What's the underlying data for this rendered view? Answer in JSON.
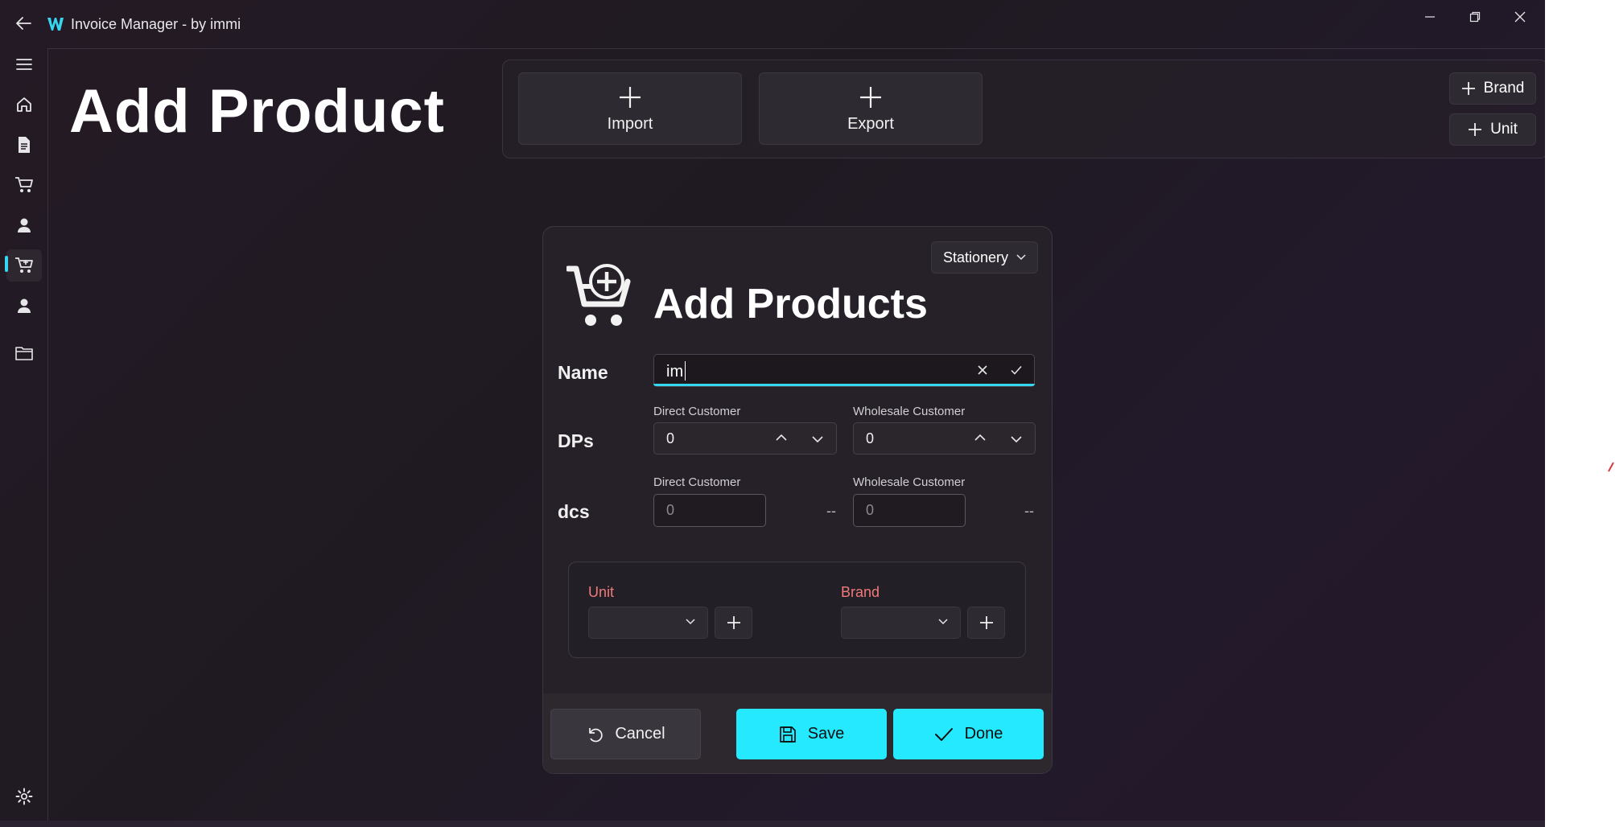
{
  "window": {
    "title": "Invoice Manager - by immi",
    "controls": [
      "minimize",
      "maximize",
      "close"
    ]
  },
  "nav": {
    "items": [
      {
        "name": "menu",
        "icon": "hamburger-icon"
      },
      {
        "name": "home",
        "icon": "home-icon"
      },
      {
        "name": "invoices",
        "icon": "document-icon"
      },
      {
        "name": "cart",
        "icon": "cart-icon"
      },
      {
        "name": "customers",
        "icon": "person-icon"
      },
      {
        "name": "products",
        "icon": "cart-add-icon",
        "active": true
      },
      {
        "name": "users",
        "icon": "person-icon"
      },
      {
        "name": "files",
        "icon": "folder-icon"
      },
      {
        "name": "settings",
        "icon": "gear-icon"
      }
    ]
  },
  "page": {
    "title": "Add Product"
  },
  "commandbar": {
    "import_label": "Import",
    "export_label": "Export",
    "brand_label": "Brand",
    "unit_label": "Unit"
  },
  "dialog": {
    "category": "Stationery",
    "title": "Add Products",
    "name_label": "Name",
    "name_value": "im",
    "dps_label": "DPs",
    "dcs_label": "dcs",
    "direct_customer_label": "Direct Customer",
    "wholesale_customer_label": "Wholesale Customer",
    "dp_direct_value": "0",
    "dp_wholesale_value": "0",
    "dcs_direct_placeholder": "0",
    "dcs_wholesale_placeholder": "0",
    "dcs_direct_suffix": "--",
    "dcs_wholesale_suffix": "--",
    "unit_label": "Unit",
    "brand_label": "Brand",
    "cancel_label": "Cancel",
    "save_label": "Save",
    "done_label": "Done"
  },
  "colors": {
    "accent": "#25eaff",
    "required_label": "#f07a7a",
    "background": "#231b26"
  }
}
